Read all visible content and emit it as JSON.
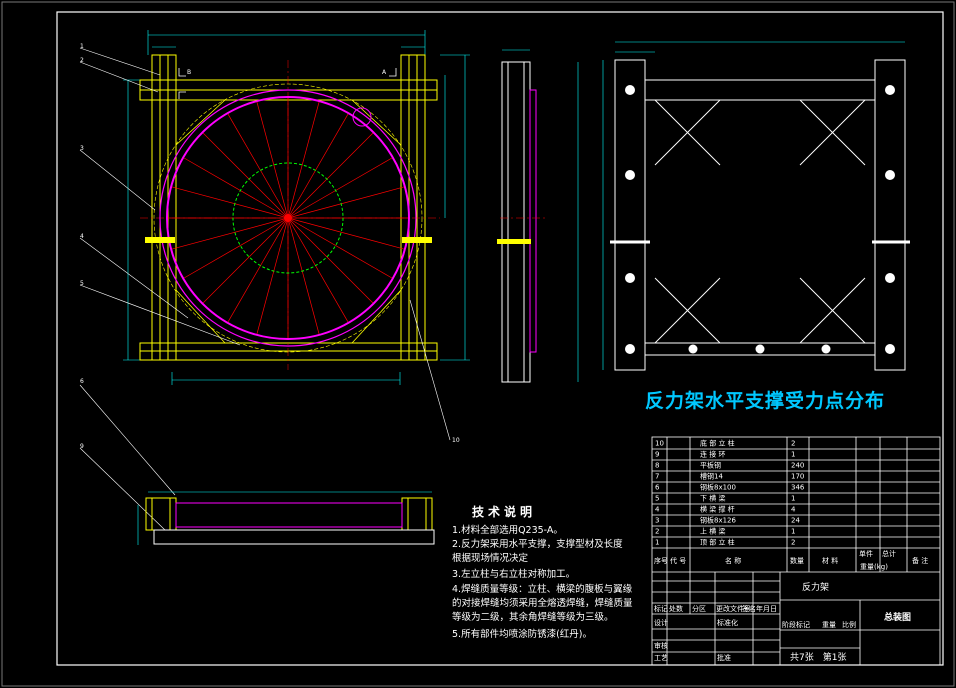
{
  "drawing": {
    "subtitle": "反力架水平支撑受力点分布",
    "notes_title": "技术说明",
    "notes": [
      "1.材料全部选用Q235-A。",
      "2.反力架采用水平支撑，支撑型材及长度",
      "   根据现场情况决定",
      "3.左立柱与右立柱对称加工。",
      "4.焊缝质量等级：立柱、横梁的腹板与翼缘",
      "   的对接焊缝均须采用全熔透焊缝，焊缝质量",
      "   等级为二级，其余角焊缝等级为三级。",
      "5.所有部件均喷涂防锈漆(红丹)。"
    ],
    "part_tags": [
      "1",
      "2",
      "3",
      "4",
      "5",
      "10",
      "6",
      "9"
    ],
    "bom_rows": [
      {
        "no": "10",
        "name": "底 部 立 柱",
        "qty": "2",
        "weight": ""
      },
      {
        "no": "9",
        "name": "连 接 环",
        "qty": "1",
        "weight": ""
      },
      {
        "no": "8",
        "name": "平板钢",
        "qty": "240",
        "weight": ""
      },
      {
        "no": "7",
        "name": "槽钢14",
        "qty": "170",
        "weight": ""
      },
      {
        "no": "6",
        "name": "钢板8x100",
        "qty": "346",
        "weight": ""
      },
      {
        "no": "5",
        "name": "下 横 梁",
        "qty": "1",
        "weight": ""
      },
      {
        "no": "4",
        "name": "横 梁 撑 杆",
        "qty": "4",
        "weight": ""
      },
      {
        "no": "3",
        "name": "钢板8x126",
        "qty": "24",
        "weight": ""
      },
      {
        "no": "2",
        "name": "上 横 梁",
        "qty": "1",
        "weight": ""
      },
      {
        "no": "1",
        "name": "顶 部 立 柱",
        "qty": "2",
        "weight": ""
      }
    ],
    "bom_header": {
      "no": "序号",
      "code": "代 号",
      "name": "名 称",
      "qty": "数量",
      "material": "材 料",
      "unit_w": "单件",
      "total_w": "总计",
      "weight_label": "重量(kg)",
      "remark": "备 注"
    },
    "title_block": {
      "part_name": "反力架",
      "drawing_title": "总装图",
      "sheets": "共7张　第1张",
      "row_labels": [
        "标记",
        "处数",
        "分区",
        "更改文件号",
        "签名",
        "年月日"
      ],
      "roles": [
        "设计",
        "标准化",
        "审核",
        "工艺",
        "批准"
      ],
      "stage_labels": [
        "阶段标记",
        "重量",
        "比例"
      ]
    }
  },
  "colors": {
    "frame": "#ffffff",
    "beam": "#ffff00",
    "ring": "#ff00ff",
    "radial": "#ff0000",
    "inner": "#00ff00",
    "dim": "#00ffff",
    "title": "#00c8ff"
  }
}
